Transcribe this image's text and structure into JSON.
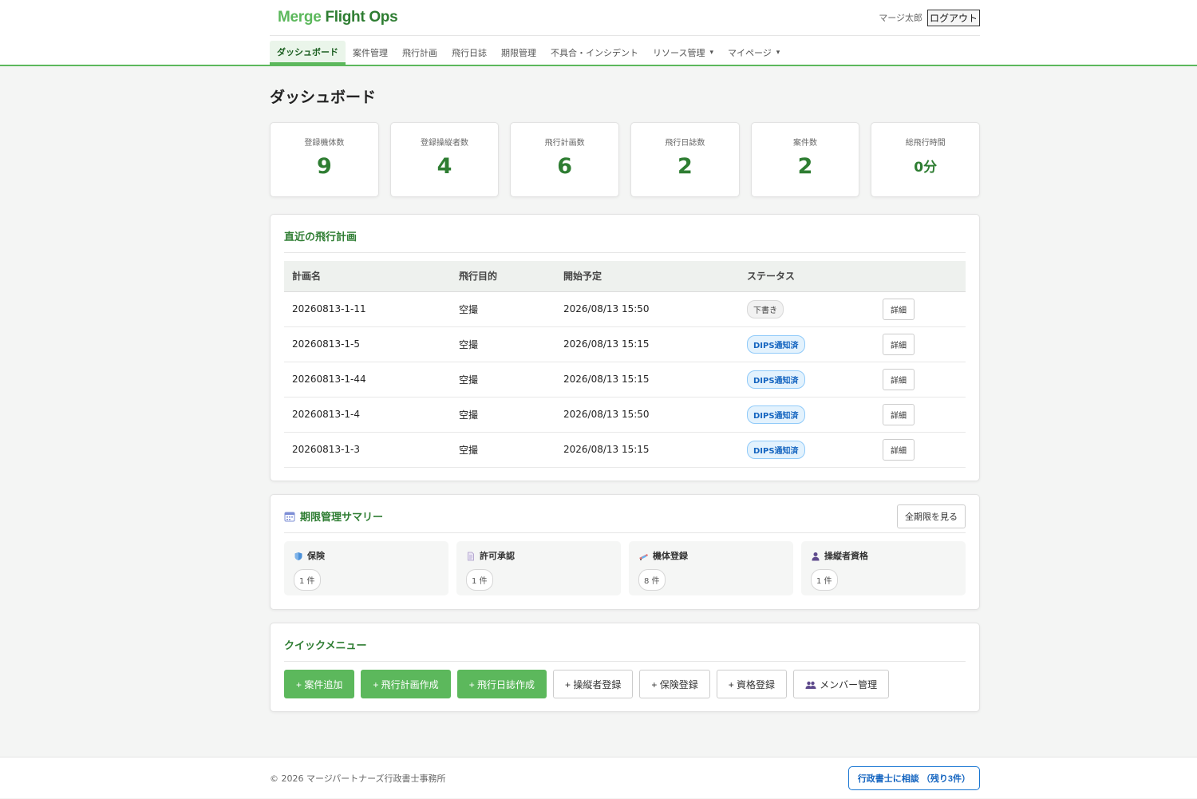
{
  "app": {
    "logo_part1": "Merge",
    "logo_part2": " Flight Ops"
  },
  "user": {
    "name": "マージ太郎",
    "logout_label": "ログアウト"
  },
  "nav": {
    "items": [
      {
        "label": "ダッシュボード",
        "active": true
      },
      {
        "label": "案件管理"
      },
      {
        "label": "飛行計画"
      },
      {
        "label": "飛行日誌"
      },
      {
        "label": "期限管理"
      },
      {
        "label": "不具合・インシデント"
      },
      {
        "label": "リソース管理",
        "dot": "▾"
      },
      {
        "label": "マイページ",
        "dot": "▾"
      }
    ]
  },
  "page": {
    "title": "ダッシュボード"
  },
  "stats": [
    {
      "label": "登録機体数",
      "value": "9"
    },
    {
      "label": "登録操縦者数",
      "value": "4"
    },
    {
      "label": "飛行計画数",
      "value": "6"
    },
    {
      "label": "飛行日誌数",
      "value": "2"
    },
    {
      "label": "案件数",
      "value": "2"
    },
    {
      "label": "総飛行時間",
      "value": "0分"
    }
  ],
  "recent_plans": {
    "title": "直近の飛行計画",
    "columns": [
      "計画名",
      "飛行目的",
      "開始予定",
      "ステータス",
      ""
    ],
    "detail_label": "詳細",
    "rows": [
      {
        "name": "20260813-1-11",
        "purpose": "空撮",
        "start": "2026/08/13 15:50",
        "status": "下書き",
        "status_type": "draft"
      },
      {
        "name": "20260813-1-5",
        "purpose": "空撮",
        "start": "2026/08/13 15:15",
        "status": "DIPS通知済",
        "status_type": "dips"
      },
      {
        "name": "20260813-1-44",
        "purpose": "空撮",
        "start": "2026/08/13 15:15",
        "status": "DIPS通知済",
        "status_type": "dips"
      },
      {
        "name": "20260813-1-4",
        "purpose": "空撮",
        "start": "2026/08/13 15:50",
        "status": "DIPS通知済",
        "status_type": "dips"
      },
      {
        "name": "20260813-1-3",
        "purpose": "空撮",
        "start": "2026/08/13 15:15",
        "status": "DIPS通知済",
        "status_type": "dips"
      }
    ]
  },
  "expiry": {
    "title": "期限管理サマリー",
    "view_all_label": "全期限を見る",
    "items": [
      {
        "label": "保険",
        "count": "1 件",
        "icon": "shield-icon"
      },
      {
        "label": "許可承認",
        "count": "1 件",
        "icon": "document-icon"
      },
      {
        "label": "機体登録",
        "count": "8 件",
        "icon": "drone-icon"
      },
      {
        "label": "操縦者資格",
        "count": "1 件",
        "icon": "person-icon"
      }
    ]
  },
  "quick_menu": {
    "title": "クイックメニュー",
    "buttons": [
      {
        "label": "+ 案件追加",
        "style": "primary"
      },
      {
        "label": "+ 飛行計画作成",
        "style": "primary"
      },
      {
        "label": "+ 飛行日誌作成",
        "style": "primary"
      },
      {
        "label": "+ 操縦者登録",
        "style": "secondary"
      },
      {
        "label": "+ 保険登録",
        "style": "secondary"
      },
      {
        "label": "+ 資格登録",
        "style": "secondary"
      },
      {
        "label": "メンバー管理",
        "style": "secondary",
        "icon": "members-icon"
      }
    ]
  },
  "footer": {
    "copyright": "© 2026 マージパートナーズ行政書士事務所",
    "consult_label": "行政書士に相談 （残り3件）"
  },
  "colors": {
    "brand": "#2e7d32",
    "accent": "#5cb85c",
    "info": "#1565c0"
  }
}
